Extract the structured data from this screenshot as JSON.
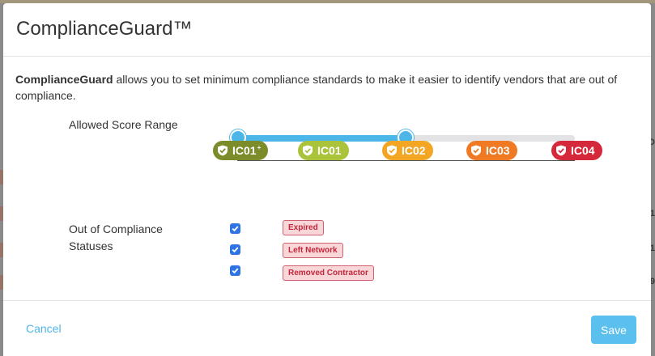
{
  "modal": {
    "title": "ComplianceGuard™",
    "intro_bold": "ComplianceGuard",
    "intro_rest": " allows you to set minimum compliance standards to make it easier to identify vendors that are out of compliance."
  },
  "score_range": {
    "label": "Allowed Score Range",
    "min_level": "IC01+",
    "max_level": "IC02",
    "levels": [
      {
        "code": "IC01",
        "sup": "+",
        "color": "#7d8c2a"
      },
      {
        "code": "IC01",
        "sup": "",
        "color": "#a9c33a"
      },
      {
        "code": "IC02",
        "sup": "",
        "color": "#f3a623"
      },
      {
        "code": "IC03",
        "sup": "",
        "color": "#f07a24"
      },
      {
        "code": "IC04",
        "sup": "",
        "color": "#d5283a"
      }
    ],
    "accent": "#4db6e8"
  },
  "out_of_compliance": {
    "label_line1": "Out of Compliance",
    "label_line2": "Statuses",
    "statuses": [
      {
        "label": "Expired",
        "checked": true
      },
      {
        "label": "Left Network",
        "checked": true
      },
      {
        "label": "Removed Contractor",
        "checked": true
      }
    ]
  },
  "footer": {
    "cancel_label": "Cancel",
    "save_label": "Save"
  },
  "background_edge": {
    "right_chars": [
      "D",
      "1",
      "1",
      "9"
    ]
  },
  "icons": {
    "badge": "shield-check-icon",
    "checkbox": "checkmark-icon"
  }
}
